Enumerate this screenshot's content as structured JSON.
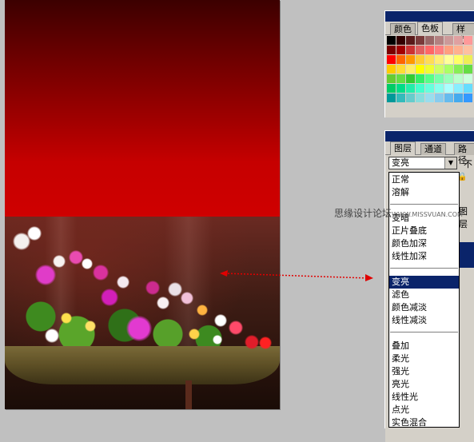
{
  "swatches_panel": {
    "tabs": [
      "颜色",
      "色板",
      "样式"
    ],
    "active_tab": 1,
    "colors": [
      [
        "#000000",
        "#330000",
        "#5a1a1a",
        "#7a3a3a",
        "#996666",
        "#b38080",
        "#cc9999",
        "#e0a0a0",
        "#ff9999"
      ],
      [
        "#7a0000",
        "#a30000",
        "#cc3333",
        "#e06060",
        "#ff6666",
        "#ff7f7f",
        "#ff9f7f",
        "#ffb08f",
        "#ffc0a0"
      ],
      [
        "#ff0000",
        "#ff6600",
        "#ff9900",
        "#ffcc33",
        "#ffdd55",
        "#ffee77",
        "#ffff99",
        "#ffff66",
        "#eeee55"
      ],
      [
        "#ffcc00",
        "#ffdd33",
        "#ffee66",
        "#ffff00",
        "#eeff33",
        "#ccff66",
        "#aaff66",
        "#88ee55",
        "#66dd44"
      ],
      [
        "#66cc33",
        "#66dd44",
        "#33cc33",
        "#33ee66",
        "#55ff88",
        "#77ffaa",
        "#99ffbb",
        "#bbffcc",
        "#ccffdd"
      ],
      [
        "#00cc66",
        "#00dd88",
        "#22eeaa",
        "#44ffcc",
        "#66ffdd",
        "#88ffee",
        "#aaffff",
        "#88eeff",
        "#66ddff"
      ],
      [
        "#009999",
        "#33bbbb",
        "#66cccc",
        "#88dddd",
        "#99ddee",
        "#88ccee",
        "#66bbee",
        "#44aaee",
        "#3399ff"
      ]
    ]
  },
  "layers_panel": {
    "tabs": [
      "图层",
      "通道",
      "路径"
    ],
    "active_tab": 0,
    "mode_value": "变亮",
    "opacity_label": "不",
    "partial_layer_label": "图层"
  },
  "blend_dropdown": {
    "groups": [
      [
        "正常",
        "溶解"
      ],
      [
        "变暗",
        "正片叠底",
        "颜色加深",
        "线性加深"
      ],
      [
        "变亮",
        "滤色",
        "颜色减淡",
        "线性减淡"
      ],
      [
        "叠加",
        "柔光",
        "强光",
        "亮光",
        "线性光",
        "点光",
        "实色混合"
      ]
    ],
    "selected": "变亮"
  },
  "watermark": {
    "text": "思缘设计论坛",
    "url": "WWW.MISSVUAN.COM"
  }
}
